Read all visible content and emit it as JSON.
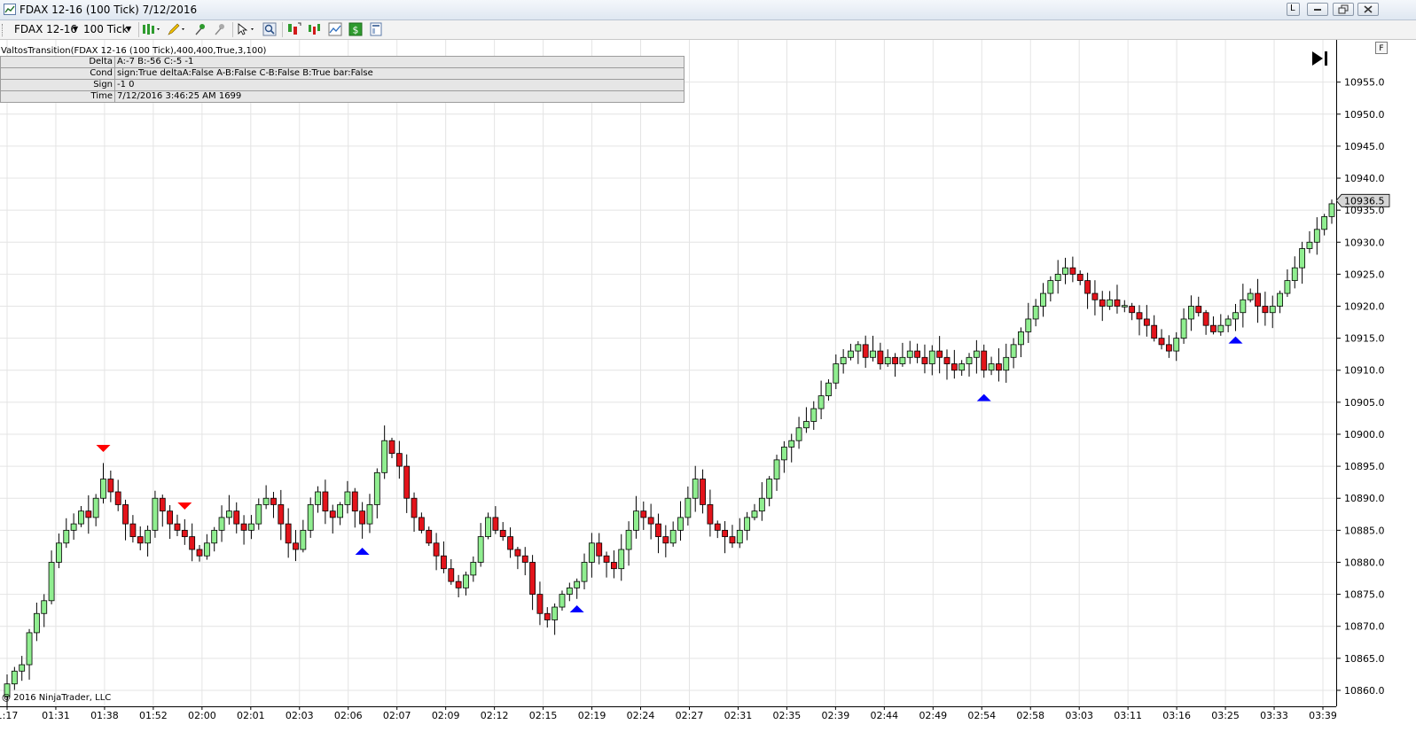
{
  "window": {
    "title": "FDAX 12-16 (100 Tick)  7/12/2016"
  },
  "toolbar": {
    "instrument": "FDAX 12-16",
    "interval": "100 Tick",
    "icons": [
      "bar-type-icon",
      "pencil-icon",
      "pin-icon",
      "pin-gray-icon",
      "cursor-icon",
      "zoom-icon",
      "strategy-icon",
      "indicator-icon",
      "chart-data-icon",
      "dollar-icon",
      "properties-icon"
    ]
  },
  "indicator": {
    "label": "ValtosTransition(FDAX 12-16 (100 Tick),400,400,True,3,100)",
    "rows": [
      {
        "key": "Delta",
        "value": "A:-7 B:-56 C:-5 -1"
      },
      {
        "key": "Cond",
        "value": "sign:True deltaA:False A-B:False C-B:False B:True bar:False"
      },
      {
        "key": "Sign",
        "value": "-1 0"
      },
      {
        "key": "Time",
        "value": "7/12/2016 3:46:25 AM 1699"
      }
    ]
  },
  "copyright": "@ 2016 NinjaTrader, LLC",
  "axis_button": "F",
  "colors": {
    "up": "#90ee90",
    "down": "#e3141b",
    "wick": "#000000",
    "grid": "#e4e4e4",
    "buy": "#0000ff",
    "sell": "#ff0000"
  },
  "chart_data": {
    "type": "candlestick",
    "title": "",
    "y_ticks": [
      "10955.0",
      "10950.0",
      "10945.0",
      "10940.0",
      "10935.0",
      "10930.0",
      "10925.0",
      "10920.0",
      "10915.0",
      "10910.0",
      "10905.0",
      "10900.0",
      "10895.0",
      "10890.0",
      "10885.0",
      "10880.0",
      "10875.0",
      "10870.0",
      "10865.0",
      "10860.0"
    ],
    "y_tick_values": [
      10955,
      10950,
      10945,
      10940,
      10935,
      10930,
      10925,
      10920,
      10915,
      10910,
      10905,
      10900,
      10895,
      10890,
      10885,
      10880,
      10875,
      10870,
      10865,
      10860
    ],
    "ylim": [
      10857.5,
      10961.6
    ],
    "x_ticks": [
      "1:17",
      "01:31",
      "01:38",
      "01:52",
      "02:00",
      "02:01",
      "02:03",
      "02:06",
      "02:07",
      "02:09",
      "02:12",
      "02:15",
      "02:19",
      "02:24",
      "02:27",
      "02:31",
      "02:35",
      "02:39",
      "02:44",
      "02:49",
      "02:54",
      "02:58",
      "03:03",
      "03:11",
      "03:16",
      "03:25",
      "03:33",
      "03:39"
    ],
    "current_price": "10936.5",
    "closes": [
      10861,
      10863,
      10864,
      10869,
      10872,
      10874,
      10880,
      10883,
      10885,
      10886,
      10888,
      10887,
      10890,
      10893,
      10891,
      10889,
      10886,
      10884,
      10883,
      10885,
      10890,
      10888,
      10886,
      10885,
      10884,
      10882,
      10881,
      10883,
      10885,
      10887,
      10888,
      10886,
      10885,
      10886,
      10889,
      10890,
      10889,
      10886,
      10883,
      10882,
      10885,
      10889,
      10891,
      10888,
      10887,
      10889,
      10891,
      10888,
      10886,
      10889,
      10894,
      10899,
      10897,
      10895,
      10890,
      10887,
      10885,
      10883,
      10881,
      10879,
      10877,
      10876,
      10878,
      10880,
      10884,
      10887,
      10885,
      10884,
      10882,
      10881,
      10880,
      10875,
      10872,
      10871,
      10873,
      10875,
      10876,
      10877,
      10880,
      10883,
      10881,
      10880,
      10879,
      10882,
      10885,
      10888,
      10887,
      10886,
      10884,
      10883,
      10885,
      10887,
      10890,
      10893,
      10889,
      10886,
      10885,
      10884,
      10883,
      10885,
      10887,
      10888,
      10890,
      10893,
      10896,
      10898,
      10899,
      10901,
      10902,
      10904,
      10906,
      10908,
      10911,
      10912,
      10913,
      10914,
      10912,
      10913,
      10911,
      10912,
      10911,
      10912,
      10913,
      10912,
      10911,
      10913,
      10912,
      10911,
      10910,
      10911,
      10912,
      10913,
      10910,
      10911,
      10910,
      10912,
      10914,
      10916,
      10918,
      10920,
      10922,
      10924,
      10925,
      10926,
      10925,
      10924,
      10922,
      10921,
      10920,
      10921,
      10920,
      10920,
      10919,
      10918,
      10917,
      10915,
      10914,
      10913,
      10915,
      10918,
      10920,
      10919,
      10917,
      10916,
      10917,
      10918,
      10919,
      10921,
      10922,
      10920,
      10919,
      10920,
      10922,
      10924,
      10926,
      10929,
      10930,
      10932,
      10934,
      10936
    ],
    "signals": [
      {
        "type": "sell",
        "index": 13
      },
      {
        "type": "sell",
        "index": 24
      },
      {
        "type": "buy",
        "index": 48
      },
      {
        "type": "buy",
        "index": 77
      },
      {
        "type": "buy",
        "index": 132
      },
      {
        "type": "buy",
        "index": 166
      }
    ]
  }
}
